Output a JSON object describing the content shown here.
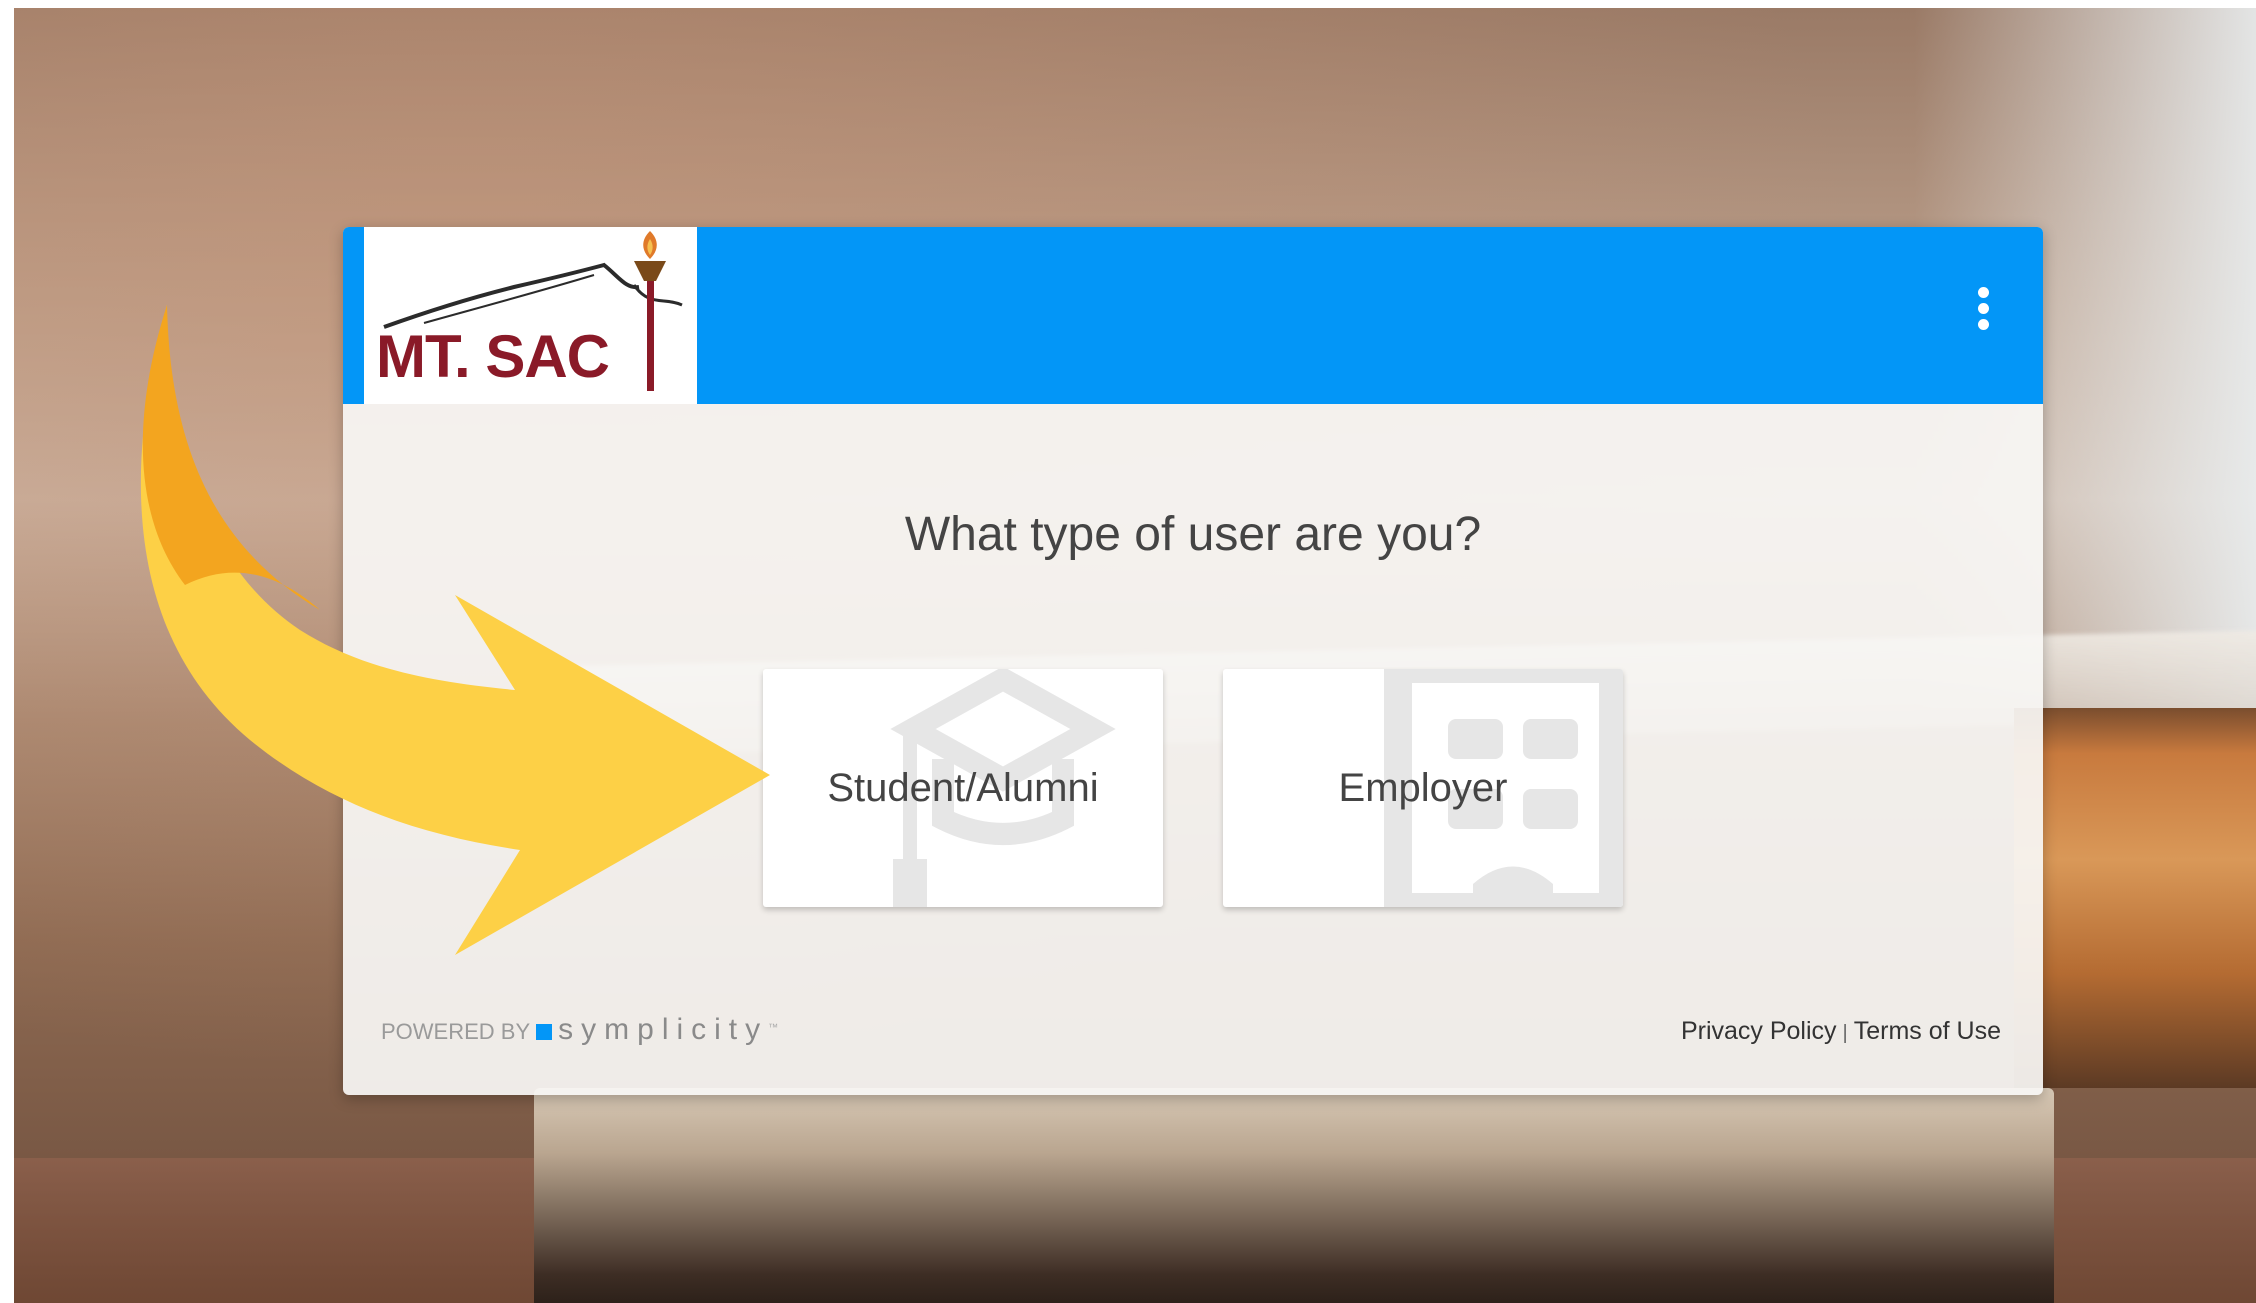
{
  "header": {
    "logo_text": "MT. SAC",
    "menu_icon": "more-vert-icon",
    "accent_color": "#0396f7"
  },
  "main": {
    "question": "What type of user are you?",
    "choices": [
      {
        "label": "Student/Alumni",
        "icon": "graduation-cap-icon"
      },
      {
        "label": "Employer",
        "icon": "building-icon"
      }
    ]
  },
  "footer": {
    "powered_by": "POWERED BY",
    "brand": "symplicity",
    "brand_mark": "™",
    "privacy_label": "Privacy Policy",
    "separator": "|",
    "terms_label": "Terms of Use"
  },
  "annotation": {
    "arrow_color": "#f9c440",
    "arrow_icon": "curved-arrow-icon"
  }
}
